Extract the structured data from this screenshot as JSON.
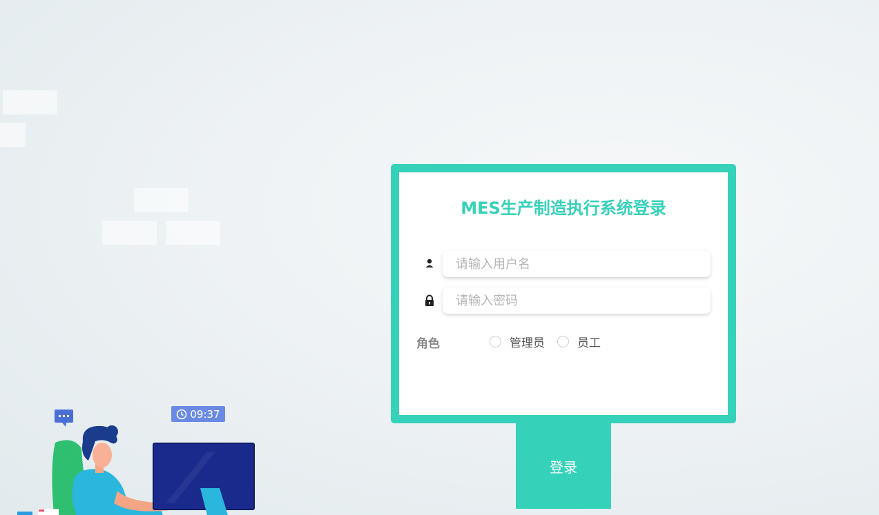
{
  "login": {
    "title": "MES生产制造执行系统登录",
    "username_placeholder": "请输入用户名",
    "password_placeholder": "请输入密码",
    "role_label": "角色",
    "roles": [
      "管理员",
      "员工"
    ],
    "submit_label": "登录"
  },
  "illustration": {
    "clock_time": "09:37"
  },
  "colors": {
    "accent": "#36d1b9",
    "badge": "#6b8ae6",
    "monitor": "#1a2a8c"
  }
}
